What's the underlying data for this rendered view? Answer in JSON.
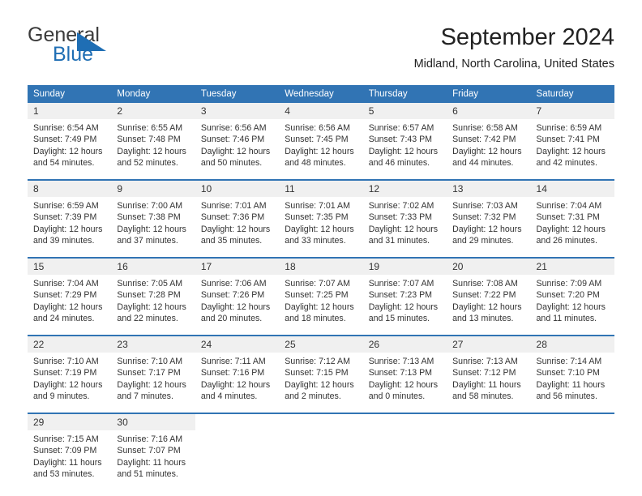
{
  "brand": {
    "name_top": "General",
    "name_bottom": "Blue",
    "accent_color": "#1f6eb4",
    "text_color": "#3b3b3b"
  },
  "header": {
    "title": "September 2024",
    "subtitle": "Midland, North Carolina, United States"
  },
  "calendar": {
    "header_bg": "#3174b4",
    "daynum_bg": "#f0f0f0",
    "weekdays": [
      "Sunday",
      "Monday",
      "Tuesday",
      "Wednesday",
      "Thursday",
      "Friday",
      "Saturday"
    ],
    "weeks": [
      [
        {
          "day": "1",
          "sunrise": "Sunrise: 6:54 AM",
          "sunset": "Sunset: 7:49 PM",
          "daylight_1": "Daylight: 12 hours",
          "daylight_2": "and 54 minutes."
        },
        {
          "day": "2",
          "sunrise": "Sunrise: 6:55 AM",
          "sunset": "Sunset: 7:48 PM",
          "daylight_1": "Daylight: 12 hours",
          "daylight_2": "and 52 minutes."
        },
        {
          "day": "3",
          "sunrise": "Sunrise: 6:56 AM",
          "sunset": "Sunset: 7:46 PM",
          "daylight_1": "Daylight: 12 hours",
          "daylight_2": "and 50 minutes."
        },
        {
          "day": "4",
          "sunrise": "Sunrise: 6:56 AM",
          "sunset": "Sunset: 7:45 PM",
          "daylight_1": "Daylight: 12 hours",
          "daylight_2": "and 48 minutes."
        },
        {
          "day": "5",
          "sunrise": "Sunrise: 6:57 AM",
          "sunset": "Sunset: 7:43 PM",
          "daylight_1": "Daylight: 12 hours",
          "daylight_2": "and 46 minutes."
        },
        {
          "day": "6",
          "sunrise": "Sunrise: 6:58 AM",
          "sunset": "Sunset: 7:42 PM",
          "daylight_1": "Daylight: 12 hours",
          "daylight_2": "and 44 minutes."
        },
        {
          "day": "7",
          "sunrise": "Sunrise: 6:59 AM",
          "sunset": "Sunset: 7:41 PM",
          "daylight_1": "Daylight: 12 hours",
          "daylight_2": "and 42 minutes."
        }
      ],
      [
        {
          "day": "8",
          "sunrise": "Sunrise: 6:59 AM",
          "sunset": "Sunset: 7:39 PM",
          "daylight_1": "Daylight: 12 hours",
          "daylight_2": "and 39 minutes."
        },
        {
          "day": "9",
          "sunrise": "Sunrise: 7:00 AM",
          "sunset": "Sunset: 7:38 PM",
          "daylight_1": "Daylight: 12 hours",
          "daylight_2": "and 37 minutes."
        },
        {
          "day": "10",
          "sunrise": "Sunrise: 7:01 AM",
          "sunset": "Sunset: 7:36 PM",
          "daylight_1": "Daylight: 12 hours",
          "daylight_2": "and 35 minutes."
        },
        {
          "day": "11",
          "sunrise": "Sunrise: 7:01 AM",
          "sunset": "Sunset: 7:35 PM",
          "daylight_1": "Daylight: 12 hours",
          "daylight_2": "and 33 minutes."
        },
        {
          "day": "12",
          "sunrise": "Sunrise: 7:02 AM",
          "sunset": "Sunset: 7:33 PM",
          "daylight_1": "Daylight: 12 hours",
          "daylight_2": "and 31 minutes."
        },
        {
          "day": "13",
          "sunrise": "Sunrise: 7:03 AM",
          "sunset": "Sunset: 7:32 PM",
          "daylight_1": "Daylight: 12 hours",
          "daylight_2": "and 29 minutes."
        },
        {
          "day": "14",
          "sunrise": "Sunrise: 7:04 AM",
          "sunset": "Sunset: 7:31 PM",
          "daylight_1": "Daylight: 12 hours",
          "daylight_2": "and 26 minutes."
        }
      ],
      [
        {
          "day": "15",
          "sunrise": "Sunrise: 7:04 AM",
          "sunset": "Sunset: 7:29 PM",
          "daylight_1": "Daylight: 12 hours",
          "daylight_2": "and 24 minutes."
        },
        {
          "day": "16",
          "sunrise": "Sunrise: 7:05 AM",
          "sunset": "Sunset: 7:28 PM",
          "daylight_1": "Daylight: 12 hours",
          "daylight_2": "and 22 minutes."
        },
        {
          "day": "17",
          "sunrise": "Sunrise: 7:06 AM",
          "sunset": "Sunset: 7:26 PM",
          "daylight_1": "Daylight: 12 hours",
          "daylight_2": "and 20 minutes."
        },
        {
          "day": "18",
          "sunrise": "Sunrise: 7:07 AM",
          "sunset": "Sunset: 7:25 PM",
          "daylight_1": "Daylight: 12 hours",
          "daylight_2": "and 18 minutes."
        },
        {
          "day": "19",
          "sunrise": "Sunrise: 7:07 AM",
          "sunset": "Sunset: 7:23 PM",
          "daylight_1": "Daylight: 12 hours",
          "daylight_2": "and 15 minutes."
        },
        {
          "day": "20",
          "sunrise": "Sunrise: 7:08 AM",
          "sunset": "Sunset: 7:22 PM",
          "daylight_1": "Daylight: 12 hours",
          "daylight_2": "and 13 minutes."
        },
        {
          "day": "21",
          "sunrise": "Sunrise: 7:09 AM",
          "sunset": "Sunset: 7:20 PM",
          "daylight_1": "Daylight: 12 hours",
          "daylight_2": "and 11 minutes."
        }
      ],
      [
        {
          "day": "22",
          "sunrise": "Sunrise: 7:10 AM",
          "sunset": "Sunset: 7:19 PM",
          "daylight_1": "Daylight: 12 hours",
          "daylight_2": "and 9 minutes."
        },
        {
          "day": "23",
          "sunrise": "Sunrise: 7:10 AM",
          "sunset": "Sunset: 7:17 PM",
          "daylight_1": "Daylight: 12 hours",
          "daylight_2": "and 7 minutes."
        },
        {
          "day": "24",
          "sunrise": "Sunrise: 7:11 AM",
          "sunset": "Sunset: 7:16 PM",
          "daylight_1": "Daylight: 12 hours",
          "daylight_2": "and 4 minutes."
        },
        {
          "day": "25",
          "sunrise": "Sunrise: 7:12 AM",
          "sunset": "Sunset: 7:15 PM",
          "daylight_1": "Daylight: 12 hours",
          "daylight_2": "and 2 minutes."
        },
        {
          "day": "26",
          "sunrise": "Sunrise: 7:13 AM",
          "sunset": "Sunset: 7:13 PM",
          "daylight_1": "Daylight: 12 hours",
          "daylight_2": "and 0 minutes."
        },
        {
          "day": "27",
          "sunrise": "Sunrise: 7:13 AM",
          "sunset": "Sunset: 7:12 PM",
          "daylight_1": "Daylight: 11 hours",
          "daylight_2": "and 58 minutes."
        },
        {
          "day": "28",
          "sunrise": "Sunrise: 7:14 AM",
          "sunset": "Sunset: 7:10 PM",
          "daylight_1": "Daylight: 11 hours",
          "daylight_2": "and 56 minutes."
        }
      ],
      [
        {
          "day": "29",
          "sunrise": "Sunrise: 7:15 AM",
          "sunset": "Sunset: 7:09 PM",
          "daylight_1": "Daylight: 11 hours",
          "daylight_2": "and 53 minutes."
        },
        {
          "day": "30",
          "sunrise": "Sunrise: 7:16 AM",
          "sunset": "Sunset: 7:07 PM",
          "daylight_1": "Daylight: 11 hours",
          "daylight_2": "and 51 minutes."
        },
        {
          "day": "",
          "sunrise": "",
          "sunset": "",
          "daylight_1": "",
          "daylight_2": ""
        },
        {
          "day": "",
          "sunrise": "",
          "sunset": "",
          "daylight_1": "",
          "daylight_2": ""
        },
        {
          "day": "",
          "sunrise": "",
          "sunset": "",
          "daylight_1": "",
          "daylight_2": ""
        },
        {
          "day": "",
          "sunrise": "",
          "sunset": "",
          "daylight_1": "",
          "daylight_2": ""
        },
        {
          "day": "",
          "sunrise": "",
          "sunset": "",
          "daylight_1": "",
          "daylight_2": ""
        }
      ]
    ]
  }
}
